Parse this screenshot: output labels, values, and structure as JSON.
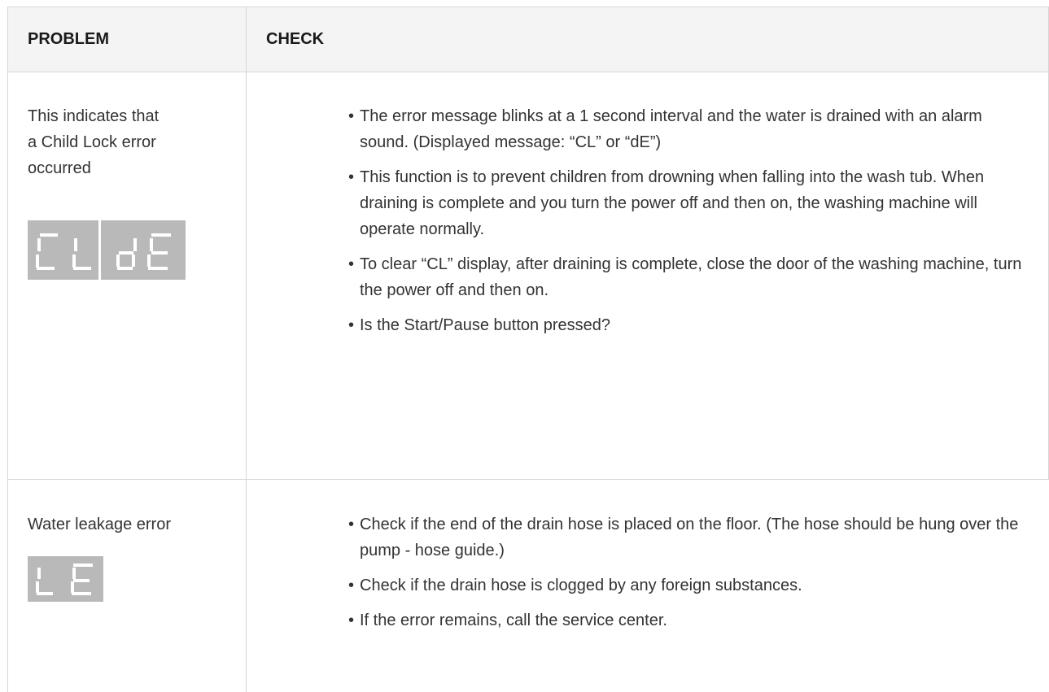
{
  "header": {
    "problem_label": "PROBLEM",
    "check_label": "CHECK"
  },
  "rows": [
    {
      "problem_lines": [
        "This indicates that",
        "a Child Lock error",
        "occurred"
      ],
      "display_codes": [
        "CL",
        "dE"
      ],
      "checks": [
        "The error message blinks at a 1 second interval and the water is drained with an alarm sound. (Displayed message: “CL” or “dE”)",
        "This function is to prevent children from drowning when falling into the wash tub. When draining is complete and you turn the power off and then on, the washing machine will operate normally.",
        "To clear “CL” display, after draining is complete, close the door of the washing machine, turn the power off and then on.",
        "Is the Start/Pause button pressed?"
      ]
    },
    {
      "problem_lines": [
        "Water leakage error"
      ],
      "display_codes": [
        "LE"
      ],
      "checks": [
        "Check if the end of the drain hose is placed on the floor. (The hose should be hung over the pump - hose guide.)",
        "Check if the drain hose is clogged by any foreign substances.",
        "If the error remains, call the service center."
      ]
    }
  ],
  "colors": {
    "border": "#d6d6d6",
    "header_bg": "#f4f4f4",
    "lcd_bg": "#b9b9b9",
    "lcd_segment": "#ffffff"
  }
}
